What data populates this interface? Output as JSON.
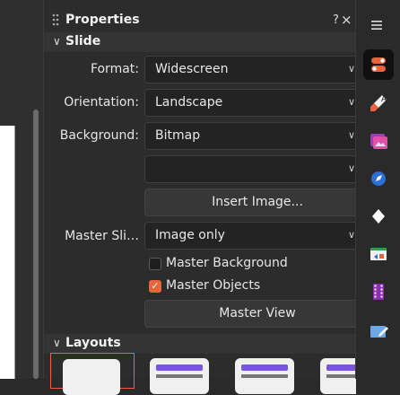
{
  "panel": {
    "title": "Properties",
    "help_label": "?",
    "close_label": "×"
  },
  "slide_section": {
    "title": "Slide",
    "format_label": "Format:",
    "format_value": "Widescreen",
    "orientation_label": "Orientation:",
    "orientation_value": "Landscape",
    "background_label": "Background:",
    "background_value": "Bitmap",
    "bitmap_value": "",
    "insert_image_label": "Insert Image...",
    "master_slide_label": "Master Sli…",
    "master_slide_value": "Image only",
    "master_background_label": "Master Background",
    "master_background_checked": false,
    "master_objects_label": "Master Objects",
    "master_objects_checked": true,
    "master_view_label": "Master View"
  },
  "layouts_section": {
    "title": "Layouts"
  },
  "sidebar": {
    "menu_icon": "hamburger-menu-icon",
    "items": [
      {
        "name": "properties-deck",
        "icon": "toggle-sliders-icon",
        "active": true
      },
      {
        "name": "styles-deck",
        "icon": "paintbrush-icon",
        "active": false
      },
      {
        "name": "gallery-deck",
        "icon": "image-gallery-icon",
        "active": false
      },
      {
        "name": "navigator-deck",
        "icon": "compass-icon",
        "active": false
      },
      {
        "name": "shapes-deck",
        "icon": "diamond-icon",
        "active": false
      },
      {
        "name": "slide-transition-deck",
        "icon": "slide-transition-icon",
        "active": false
      },
      {
        "name": "animation-deck",
        "icon": "film-strip-icon",
        "active": false
      },
      {
        "name": "master-slides-deck",
        "icon": "edit-slide-icon",
        "active": false
      }
    ]
  },
  "colors": {
    "accent": "#e9643a",
    "layout_bar": "#7b57d6",
    "panel_bg": "#2c2c2c"
  }
}
